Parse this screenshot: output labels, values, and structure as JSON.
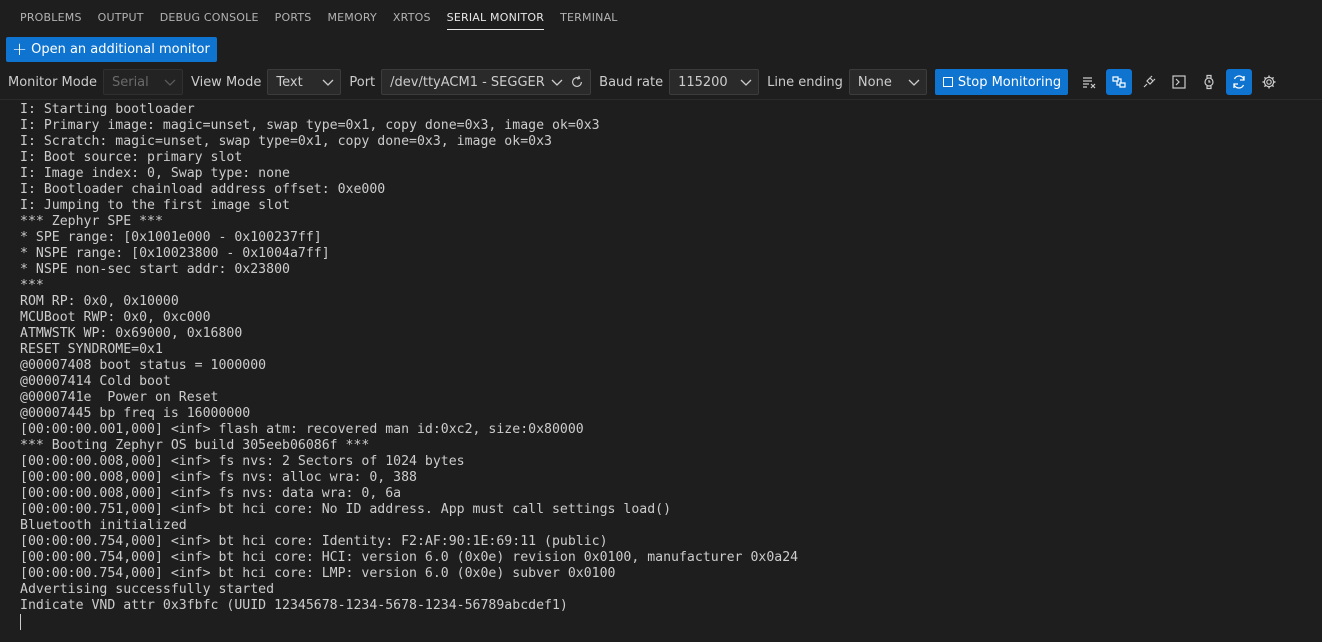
{
  "tabs": [
    "PROBLEMS",
    "OUTPUT",
    "DEBUG CONSOLE",
    "PORTS",
    "MEMORY",
    "XRTOS",
    "SERIAL MONITOR",
    "TERMINAL"
  ],
  "active_tab": "SERIAL MONITOR",
  "open_monitor_label": "Open an additional monitor",
  "toolbar": {
    "monitor_mode_label": "Monitor Mode",
    "monitor_mode_value": "Serial",
    "view_mode_label": "View Mode",
    "view_mode_value": "Text",
    "port_label": "Port",
    "port_value": "/dev/ttyACM1 - SEGGER",
    "baud_label": "Baud rate",
    "baud_value": "115200",
    "line_ending_label": "Line ending",
    "line_ending_value": "None",
    "stop_label": "Stop Monitoring"
  },
  "icons": [
    "chevron-down-icon",
    "refresh-icon",
    "clear-output-icon",
    "toggle-timestamp-icon",
    "plug-icon",
    "terminal-icon",
    "watch-icon",
    "autoscroll-icon",
    "gear-icon"
  ],
  "colors": {
    "accent": "#0e74d0",
    "background": "#1e1e1e",
    "text": "#cccccc"
  },
  "output_lines": [
    "I: Starting bootloader",
    "I: Primary image: magic=unset, swap type=0x1, copy done=0x3, image ok=0x3",
    "I: Scratch: magic=unset, swap type=0x1, copy done=0x3, image ok=0x3",
    "I: Boot source: primary slot",
    "I: Image index: 0, Swap type: none",
    "I: Bootloader chainload address offset: 0xe000",
    "I: Jumping to the first image slot",
    "*** Zephyr SPE ***",
    "* SPE range: [0x1001e000 - 0x100237ff]",
    "* NSPE range: [0x10023800 - 0x1004a7ff]",
    "* NSPE non-sec start addr: 0x23800",
    "***",
    "ROM RP: 0x0, 0x10000",
    "MCUBoot RWP: 0x0, 0xc000",
    "ATMWSTK WP: 0x69000, 0x16800",
    "RESET SYNDROME=0x1",
    "@00007408 boot status = 1000000",
    "@00007414 Cold boot",
    "@0000741e  Power on Reset",
    "@00007445 bp freq is 16000000",
    "[00:00:00.001,000] <inf> flash atm: recovered man id:0xc2, size:0x80000",
    "*** Booting Zephyr OS build 305eeb06086f ***",
    "[00:00:00.008,000] <inf> fs nvs: 2 Sectors of 1024 bytes",
    "[00:00:00.008,000] <inf> fs nvs: alloc wra: 0, 388",
    "[00:00:00.008,000] <inf> fs nvs: data wra: 0, 6a",
    "[00:00:00.751,000] <inf> bt hci core: No ID address. App must call settings load()",
    "Bluetooth initialized",
    "[00:00:00.754,000] <inf> bt hci core: Identity: F2:AF:90:1E:69:11 (public)",
    "[00:00:00.754,000] <inf> bt hci core: HCI: version 6.0 (0x0e) revision 0x0100, manufacturer 0x0a24",
    "[00:00:00.754,000] <inf> bt hci core: LMP: version 6.0 (0x0e) subver 0x0100",
    "Advertising successfully started",
    "Indicate VND attr 0x3fbfc (UUID 12345678-1234-5678-1234-56789abcdef1)"
  ]
}
